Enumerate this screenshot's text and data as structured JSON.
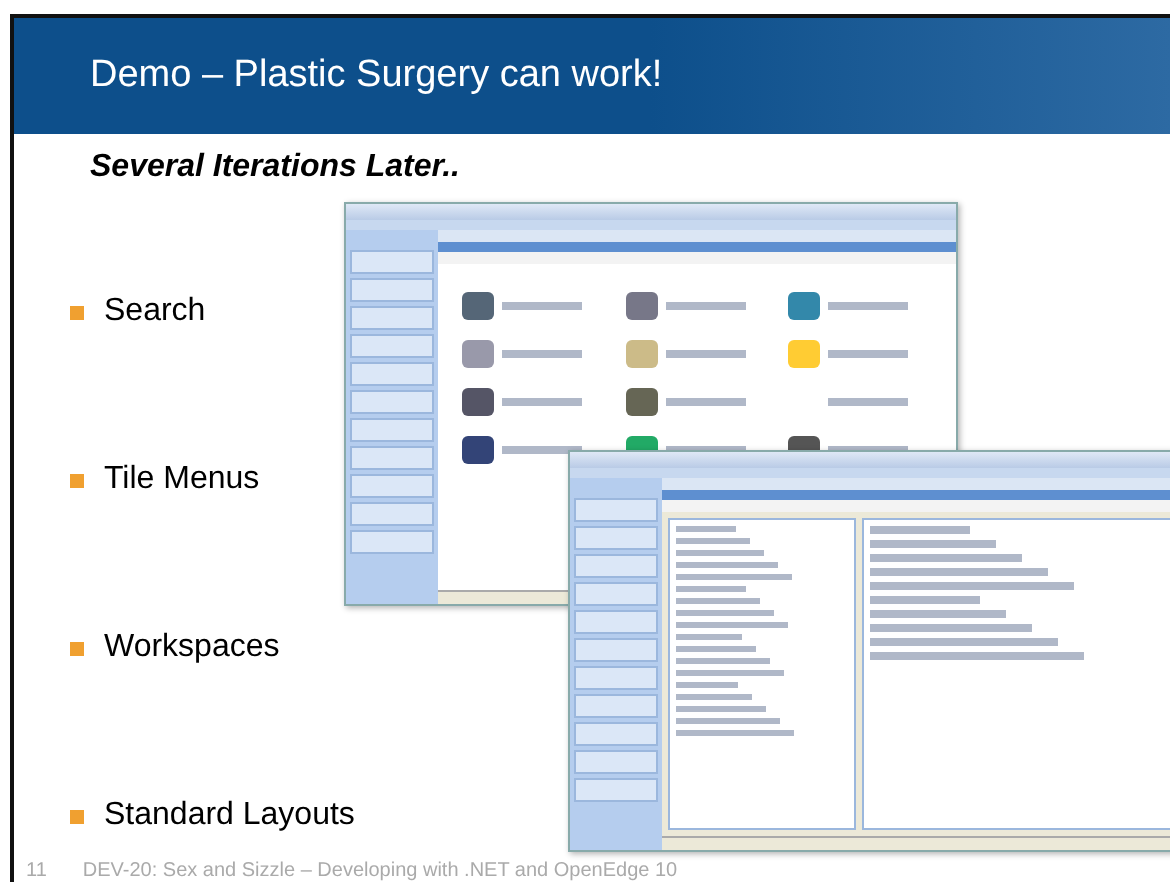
{
  "slide": {
    "title": "Demo – Plastic Surgery can work!",
    "subtitle": "Several Iterations Later..",
    "bullets": [
      "Search",
      "Tile Menus",
      "Workspaces",
      "Standard Layouts"
    ],
    "footer": {
      "page_number": "11",
      "text": "DEV-20: Sex and Sizzle – Developing with .NET and OpenEdge 10"
    }
  }
}
